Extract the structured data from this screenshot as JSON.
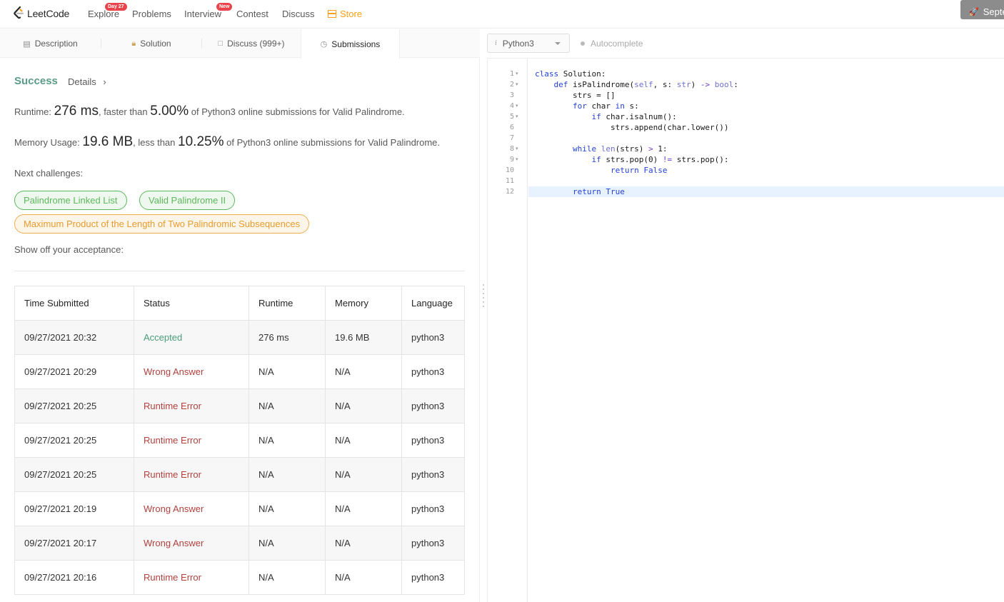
{
  "nav": {
    "logo_text": "LeetCode",
    "items": [
      {
        "label": "Explore",
        "badge": "Day 27"
      },
      {
        "label": "Problems"
      },
      {
        "label": "Interview",
        "badge": "New"
      },
      {
        "label": "Contest"
      },
      {
        "label": "Discuss"
      },
      {
        "label": "Store"
      }
    ],
    "promo_label": "Septe"
  },
  "tabs": [
    {
      "label": "Description",
      "icon": "description-icon"
    },
    {
      "label": "Solution",
      "icon": "lock-icon"
    },
    {
      "label": "Discuss (999+)",
      "icon": "discuss-icon"
    },
    {
      "label": "Submissions",
      "icon": "clock-icon",
      "active": true
    }
  ],
  "result": {
    "status": "Success",
    "details_label": "Details",
    "runtime_label": "Runtime:",
    "runtime_value": "276 ms",
    "runtime_mid": ", faster than",
    "runtime_pct": "5.00%",
    "runtime_tail": "of Python3 online submissions for Valid Palindrome.",
    "memory_label": "Memory Usage:",
    "memory_value": "19.6 MB",
    "memory_mid": ", less than",
    "memory_pct": "10.25%",
    "memory_tail": "of Python3 online submissions for Valid Palindrome.",
    "next_label": "Next challenges:",
    "challenges": [
      {
        "label": "Palindrome Linked List",
        "difficulty": "easy"
      },
      {
        "label": "Valid Palindrome II",
        "difficulty": "easy"
      },
      {
        "label": "Maximum Product of the Length of Two Palindromic Subsequences",
        "difficulty": "medium"
      }
    ],
    "show_off_label": "Show off your acceptance:"
  },
  "table": {
    "headers": [
      "Time Submitted",
      "Status",
      "Runtime",
      "Memory",
      "Language"
    ],
    "rows": [
      {
        "time": "09/27/2021 20:32",
        "status": "Accepted",
        "runtime": "276 ms",
        "memory": "19.6 MB",
        "language": "python3"
      },
      {
        "time": "09/27/2021 20:29",
        "status": "Wrong Answer",
        "runtime": "N/A",
        "memory": "N/A",
        "language": "python3"
      },
      {
        "time": "09/27/2021 20:25",
        "status": "Runtime Error",
        "runtime": "N/A",
        "memory": "N/A",
        "language": "python3"
      },
      {
        "time": "09/27/2021 20:25",
        "status": "Runtime Error",
        "runtime": "N/A",
        "memory": "N/A",
        "language": "python3"
      },
      {
        "time": "09/27/2021 20:25",
        "status": "Runtime Error",
        "runtime": "N/A",
        "memory": "N/A",
        "language": "python3"
      },
      {
        "time": "09/27/2021 20:19",
        "status": "Wrong Answer",
        "runtime": "N/A",
        "memory": "N/A",
        "language": "python3"
      },
      {
        "time": "09/27/2021 20:17",
        "status": "Wrong Answer",
        "runtime": "N/A",
        "memory": "N/A",
        "language": "python3"
      },
      {
        "time": "09/27/2021 20:16",
        "status": "Runtime Error",
        "runtime": "N/A",
        "memory": "N/A",
        "language": "python3"
      }
    ]
  },
  "editor": {
    "language": "Python3",
    "autocomplete_label": "Autocomplete",
    "active_line": 12,
    "lines": [
      "class Solution:",
      "    def isPalindrome(self, s: str) -> bool:",
      "        strs = []",
      "        for char in s:",
      "            if char.isalnum():",
      "                strs.append(char.lower())",
      "",
      "        while len(strs) > 1:",
      "            if strs.pop(0) != strs.pop():",
      "                return False",
      "",
      "        return True"
    ],
    "foldable_lines": [
      1,
      2,
      4,
      5,
      8,
      9
    ]
  },
  "colors": {
    "accent": "#ffa116",
    "success": "#5a9c84",
    "error": "#b0413e"
  }
}
